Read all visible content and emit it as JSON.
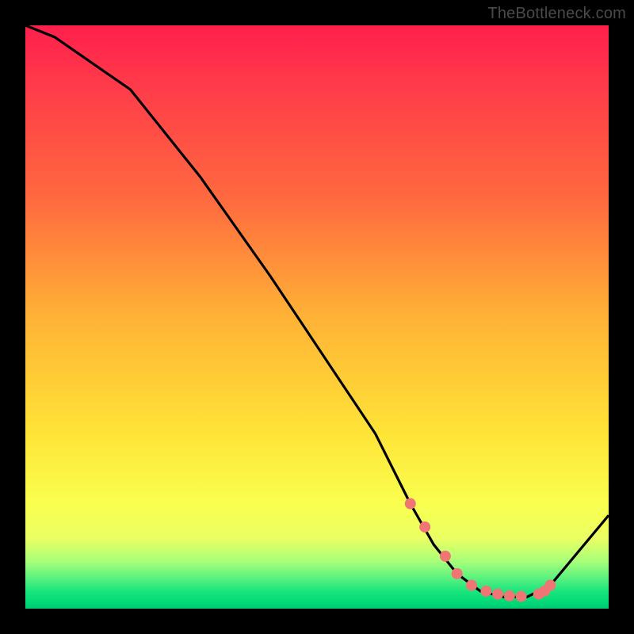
{
  "watermark": "TheBottleneck.com",
  "chart_data": {
    "type": "line",
    "title": "",
    "xlabel": "",
    "ylabel": "",
    "xlim": [
      0,
      100
    ],
    "ylim": [
      0,
      100
    ],
    "grid": false,
    "series": [
      {
        "name": "curve",
        "x": [
          0,
          5,
          18,
          30,
          42,
          54,
          60,
          66,
          70,
          74,
          78,
          82,
          86,
          90,
          100
        ],
        "y": [
          100,
          98,
          89,
          74,
          57,
          39,
          30,
          18,
          11,
          6,
          3,
          2,
          2,
          4,
          16
        ]
      }
    ],
    "markers": {
      "name": "dots",
      "color": "#f07575",
      "radius_px": 7,
      "x": [
        66,
        68.5,
        72,
        74,
        76.5,
        79,
        81,
        83,
        85,
        88,
        89,
        90
      ],
      "y": [
        18,
        14,
        9,
        6,
        4,
        3,
        2.5,
        2.2,
        2.1,
        2.5,
        3.0,
        4.0
      ]
    }
  },
  "colors": {
    "background": "#000000",
    "curve": "#000000",
    "marker": "#f07575",
    "watermark": "#4a4a4a"
  }
}
